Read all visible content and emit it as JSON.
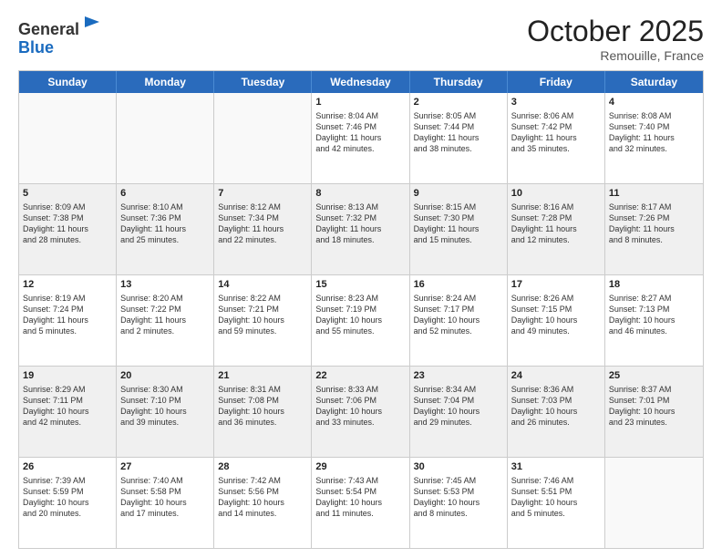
{
  "header": {
    "logo_line1": "General",
    "logo_line2": "Blue",
    "month": "October 2025",
    "location": "Remouille, France"
  },
  "days": [
    "Sunday",
    "Monday",
    "Tuesday",
    "Wednesday",
    "Thursday",
    "Friday",
    "Saturday"
  ],
  "rows": [
    [
      {
        "day": "",
        "info": ""
      },
      {
        "day": "",
        "info": ""
      },
      {
        "day": "",
        "info": ""
      },
      {
        "day": "1",
        "info": "Sunrise: 8:04 AM\nSunset: 7:46 PM\nDaylight: 11 hours\nand 42 minutes."
      },
      {
        "day": "2",
        "info": "Sunrise: 8:05 AM\nSunset: 7:44 PM\nDaylight: 11 hours\nand 38 minutes."
      },
      {
        "day": "3",
        "info": "Sunrise: 8:06 AM\nSunset: 7:42 PM\nDaylight: 11 hours\nand 35 minutes."
      },
      {
        "day": "4",
        "info": "Sunrise: 8:08 AM\nSunset: 7:40 PM\nDaylight: 11 hours\nand 32 minutes."
      }
    ],
    [
      {
        "day": "5",
        "info": "Sunrise: 8:09 AM\nSunset: 7:38 PM\nDaylight: 11 hours\nand 28 minutes."
      },
      {
        "day": "6",
        "info": "Sunrise: 8:10 AM\nSunset: 7:36 PM\nDaylight: 11 hours\nand 25 minutes."
      },
      {
        "day": "7",
        "info": "Sunrise: 8:12 AM\nSunset: 7:34 PM\nDaylight: 11 hours\nand 22 minutes."
      },
      {
        "day": "8",
        "info": "Sunrise: 8:13 AM\nSunset: 7:32 PM\nDaylight: 11 hours\nand 18 minutes."
      },
      {
        "day": "9",
        "info": "Sunrise: 8:15 AM\nSunset: 7:30 PM\nDaylight: 11 hours\nand 15 minutes."
      },
      {
        "day": "10",
        "info": "Sunrise: 8:16 AM\nSunset: 7:28 PM\nDaylight: 11 hours\nand 12 minutes."
      },
      {
        "day": "11",
        "info": "Sunrise: 8:17 AM\nSunset: 7:26 PM\nDaylight: 11 hours\nand 8 minutes."
      }
    ],
    [
      {
        "day": "12",
        "info": "Sunrise: 8:19 AM\nSunset: 7:24 PM\nDaylight: 11 hours\nand 5 minutes."
      },
      {
        "day": "13",
        "info": "Sunrise: 8:20 AM\nSunset: 7:22 PM\nDaylight: 11 hours\nand 2 minutes."
      },
      {
        "day": "14",
        "info": "Sunrise: 8:22 AM\nSunset: 7:21 PM\nDaylight: 10 hours\nand 59 minutes."
      },
      {
        "day": "15",
        "info": "Sunrise: 8:23 AM\nSunset: 7:19 PM\nDaylight: 10 hours\nand 55 minutes."
      },
      {
        "day": "16",
        "info": "Sunrise: 8:24 AM\nSunset: 7:17 PM\nDaylight: 10 hours\nand 52 minutes."
      },
      {
        "day": "17",
        "info": "Sunrise: 8:26 AM\nSunset: 7:15 PM\nDaylight: 10 hours\nand 49 minutes."
      },
      {
        "day": "18",
        "info": "Sunrise: 8:27 AM\nSunset: 7:13 PM\nDaylight: 10 hours\nand 46 minutes."
      }
    ],
    [
      {
        "day": "19",
        "info": "Sunrise: 8:29 AM\nSunset: 7:11 PM\nDaylight: 10 hours\nand 42 minutes."
      },
      {
        "day": "20",
        "info": "Sunrise: 8:30 AM\nSunset: 7:10 PM\nDaylight: 10 hours\nand 39 minutes."
      },
      {
        "day": "21",
        "info": "Sunrise: 8:31 AM\nSunset: 7:08 PM\nDaylight: 10 hours\nand 36 minutes."
      },
      {
        "day": "22",
        "info": "Sunrise: 8:33 AM\nSunset: 7:06 PM\nDaylight: 10 hours\nand 33 minutes."
      },
      {
        "day": "23",
        "info": "Sunrise: 8:34 AM\nSunset: 7:04 PM\nDaylight: 10 hours\nand 29 minutes."
      },
      {
        "day": "24",
        "info": "Sunrise: 8:36 AM\nSunset: 7:03 PM\nDaylight: 10 hours\nand 26 minutes."
      },
      {
        "day": "25",
        "info": "Sunrise: 8:37 AM\nSunset: 7:01 PM\nDaylight: 10 hours\nand 23 minutes."
      }
    ],
    [
      {
        "day": "26",
        "info": "Sunrise: 7:39 AM\nSunset: 5:59 PM\nDaylight: 10 hours\nand 20 minutes."
      },
      {
        "day": "27",
        "info": "Sunrise: 7:40 AM\nSunset: 5:58 PM\nDaylight: 10 hours\nand 17 minutes."
      },
      {
        "day": "28",
        "info": "Sunrise: 7:42 AM\nSunset: 5:56 PM\nDaylight: 10 hours\nand 14 minutes."
      },
      {
        "day": "29",
        "info": "Sunrise: 7:43 AM\nSunset: 5:54 PM\nDaylight: 10 hours\nand 11 minutes."
      },
      {
        "day": "30",
        "info": "Sunrise: 7:45 AM\nSunset: 5:53 PM\nDaylight: 10 hours\nand 8 minutes."
      },
      {
        "day": "31",
        "info": "Sunrise: 7:46 AM\nSunset: 5:51 PM\nDaylight: 10 hours\nand 5 minutes."
      },
      {
        "day": "",
        "info": ""
      }
    ]
  ]
}
